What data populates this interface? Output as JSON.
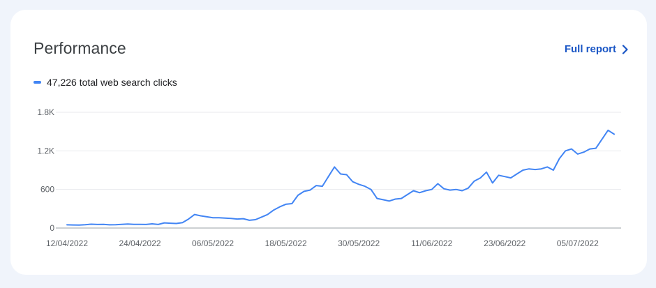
{
  "card": {
    "title": "Performance",
    "full_report_label": "Full report",
    "legend_label": "47,226 total web search clicks"
  },
  "colors": {
    "accent": "#4285f4",
    "link": "#1a56c5",
    "gridline": "#e8eaed",
    "axis": "#9aa0a6"
  },
  "icons": {
    "full_report": "chevron-right-icon"
  },
  "chart_data": {
    "type": "line",
    "ylim": [
      0,
      1800
    ],
    "y_ticks": [
      0,
      600,
      1200,
      1800
    ],
    "y_tick_labels": [
      "0",
      "600",
      "1.2K",
      "1.8K"
    ],
    "x_tick_labels": [
      "12/04/2022",
      "24/04/2022",
      "06/05/2022",
      "18/05/2022",
      "30/05/2022",
      "11/06/2022",
      "23/06/2022",
      "05/07/2022"
    ],
    "x_start_label": "12/04/2022",
    "series": [
      {
        "values": [
          50,
          48,
          47,
          52,
          60,
          55,
          58,
          50,
          52,
          58,
          62,
          58,
          57,
          55,
          65,
          55,
          80,
          75,
          70,
          85,
          140,
          210,
          190,
          175,
          160,
          160,
          155,
          150,
          140,
          145,
          120,
          130,
          170,
          210,
          280,
          330,
          370,
          380,
          510,
          570,
          590,
          660,
          650,
          800,
          950,
          840,
          830,
          720,
          680,
          650,
          600,
          460,
          440,
          420,
          450,
          460,
          520,
          580,
          550,
          580,
          600,
          690,
          610,
          590,
          600,
          580,
          620,
          730,
          780,
          870,
          700,
          820,
          800,
          780,
          840,
          900,
          920,
          910,
          920,
          950,
          900,
          1080,
          1200,
          1230,
          1150,
          1180,
          1230,
          1240,
          1380,
          1520,
          1460
        ]
      }
    ]
  }
}
